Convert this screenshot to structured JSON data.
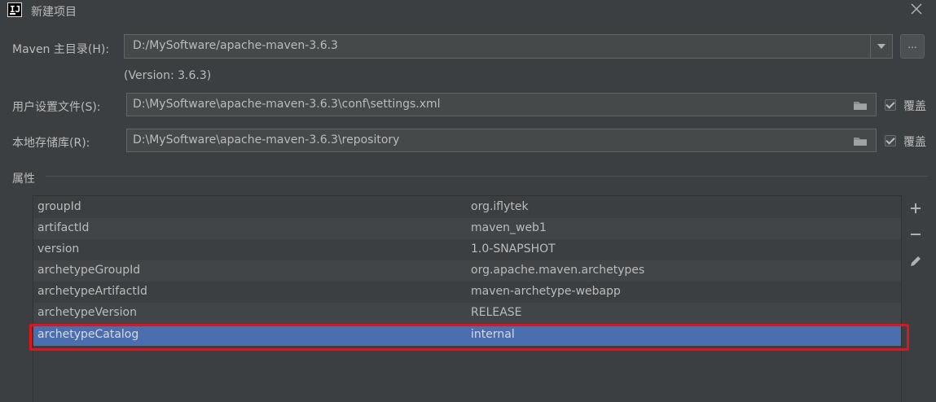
{
  "window": {
    "title": "新建项目",
    "app_icon_text": "IJ"
  },
  "maven_home": {
    "label": "Maven 主目录(H):",
    "value": "D:/MySoftware/apache-maven-3.6.3",
    "browse_label": "...",
    "version_text": "(Version: 3.6.3)"
  },
  "user_settings": {
    "label": "用户设置文件(S):",
    "value": "D:\\MySoftware\\apache-maven-3.6.3\\conf\\settings.xml",
    "override_label": "覆盖",
    "override_checked": true
  },
  "local_repo": {
    "label": "本地存储库(R):",
    "value": "D:\\MySoftware\\apache-maven-3.6.3\\repository",
    "override_label": "覆盖",
    "override_checked": true
  },
  "properties": {
    "section_title": "属性",
    "rows": [
      {
        "key": "groupId",
        "value": "org.iflytek"
      },
      {
        "key": "artifactId",
        "value": "maven_web1"
      },
      {
        "key": "version",
        "value": "1.0-SNAPSHOT"
      },
      {
        "key": "archetypeGroupId",
        "value": "org.apache.maven.archetypes"
      },
      {
        "key": "archetypeArtifactId",
        "value": "maven-archetype-webapp"
      },
      {
        "key": "archetypeVersion",
        "value": "RELEASE"
      },
      {
        "key": "archetypeCatalog",
        "value": "internal"
      }
    ],
    "selected_index": 6
  },
  "icons": {
    "close": "close-icon",
    "folder": "folder-icon",
    "add": "plus-icon",
    "remove": "minus-icon",
    "edit": "pencil-icon"
  },
  "colors": {
    "background": "#3c3f41",
    "selection": "#4b6eaf",
    "highlight_box": "#e0141d"
  }
}
